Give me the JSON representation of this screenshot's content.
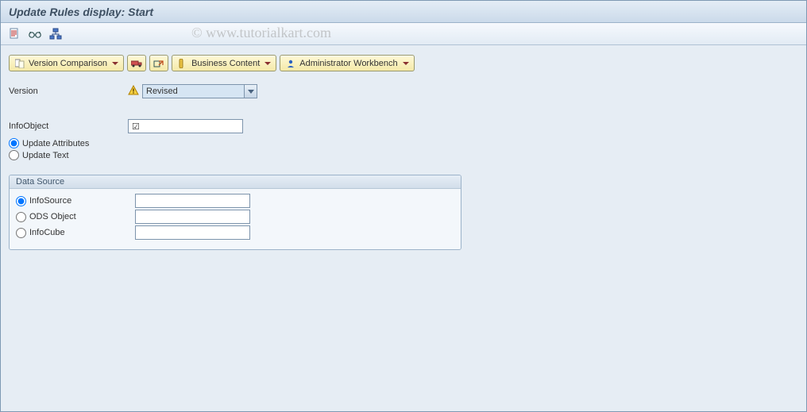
{
  "header": {
    "title": "Update Rules display: Start"
  },
  "watermark": "© www.tutorialkart.com",
  "toolbar_icons": [
    "document-icon",
    "glasses-icon",
    "hierarchy-icon"
  ],
  "buttons": {
    "version_comparison": "Version Comparison",
    "business_content": "Business Content",
    "admin_workbench": "Administrator Workbench"
  },
  "fields": {
    "version_label": "Version",
    "version_value": "Revised",
    "infoobject_label": "InfoObject",
    "infoobject_value": "",
    "infoobject_checked": "☑"
  },
  "update_options": {
    "attributes": "Update Attributes",
    "text": "Update Text",
    "selected": "attributes"
  },
  "data_source": {
    "title": "Data Source",
    "options": {
      "infosource": "InfoSource",
      "ods": "ODS Object",
      "infocube": "InfoCube"
    },
    "selected": "infosource",
    "values": {
      "infosource": "",
      "ods": "",
      "infocube": ""
    }
  },
  "colors": {
    "accent": "#d6e5f3",
    "button": "#f4e9a8",
    "border": "#7d94ac"
  }
}
